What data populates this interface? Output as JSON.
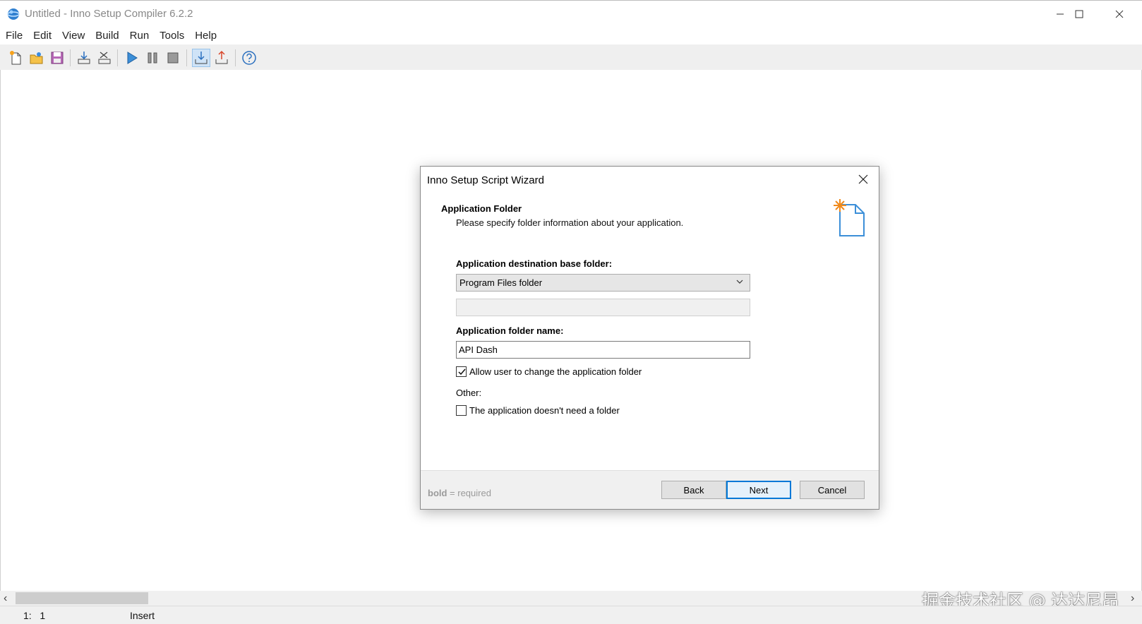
{
  "window": {
    "title": "Untitled - Inno Setup Compiler 6.2.2"
  },
  "menu": [
    "File",
    "Edit",
    "View",
    "Build",
    "Run",
    "Tools",
    "Help"
  ],
  "toolbar": {
    "icons": [
      "new-file-icon",
      "open-file-icon",
      "save-icon",
      "compile-icon",
      "stop-compile-icon",
      "run-icon",
      "pause-icon",
      "stop-icon",
      "target-setup-icon",
      "target-uninstall-icon",
      "help-icon"
    ]
  },
  "dialog": {
    "title": "Inno Setup Script Wizard",
    "header_title": "Application Folder",
    "header_subtitle": "Please specify folder information about your application.",
    "base_folder_label": "Application destination base folder:",
    "base_folder_value": "Program Files folder",
    "folder_name_label": "Application folder name:",
    "folder_name_value": "API Dash",
    "allow_change_label": "Allow user to change the application folder",
    "allow_change_checked": true,
    "other_label": "Other:",
    "no_folder_label": "The application doesn't need a folder",
    "no_folder_checked": false,
    "legend_bold": "bold",
    "legend_rest": " = required",
    "back_button": "Back",
    "next_button": "Next",
    "cancel_button": "Cancel"
  },
  "status": {
    "position": "1:   1",
    "mode": "Insert"
  },
  "watermark": "掘金技术社区 @ 达达尼昂",
  "colors": {
    "accent": "#0078d7",
    "toolbar_bg": "#efefef"
  }
}
